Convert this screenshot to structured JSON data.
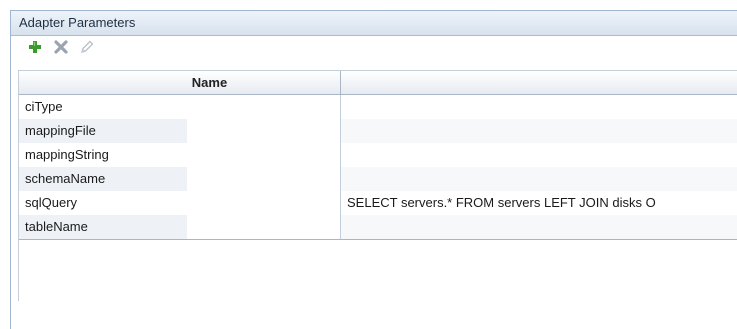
{
  "panel": {
    "title": "Adapter Parameters"
  },
  "toolbar": {
    "add": {
      "icon": "plus-icon",
      "color": "#3a9b2d",
      "enabled": true
    },
    "delete": {
      "icon": "delete-icon",
      "color": "#9aa5b1",
      "enabled": false
    },
    "edit": {
      "icon": "pencil-icon",
      "color": "#b6bfc9",
      "enabled": false
    }
  },
  "table": {
    "columns": [
      "Name",
      ""
    ],
    "rows": [
      {
        "name": "ciType",
        "value": ""
      },
      {
        "name": "mappingFile",
        "value": ""
      },
      {
        "name": "mappingString",
        "value": ""
      },
      {
        "name": "schemaName",
        "value": ""
      },
      {
        "name": "sqlQuery",
        "value": "SELECT servers.* FROM servers LEFT JOIN disks O"
      },
      {
        "name": "tableName",
        "value": ""
      }
    ]
  }
}
